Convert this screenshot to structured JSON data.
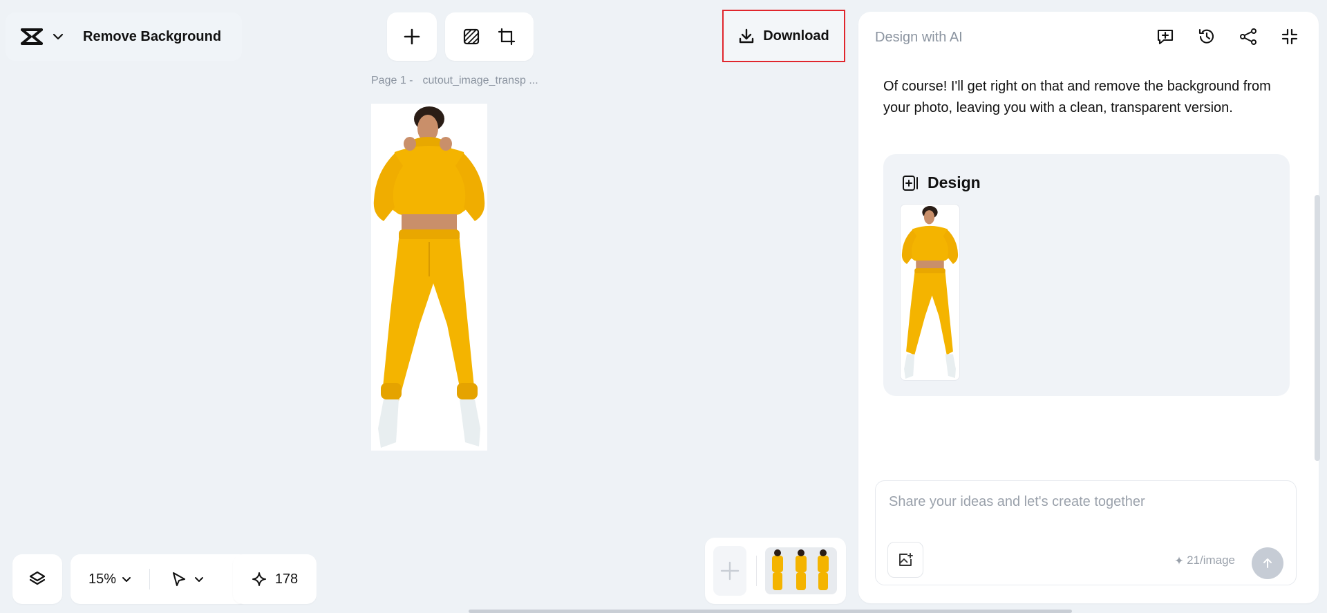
{
  "app": {
    "title": "Remove Background",
    "logo_icon": "capcut-logo-icon"
  },
  "toolbar": {
    "add_icon": "plus-icon",
    "tools": [
      "pattern-fill-icon",
      "resize-frame-icon"
    ],
    "download_label": "Download",
    "download_icon": "download-icon"
  },
  "canvas": {
    "page_label": "Page 1 -",
    "file_name": "cutout_image_transp ...",
    "image_description": "Person in yellow hoodie and sweatpants with white boots on transparent background"
  },
  "bottom_controls": {
    "layers_icon": "layers-icon",
    "zoom": "15%",
    "pointer_icon": "pointer-icon",
    "credits": "178",
    "credits_icon": "sparkle-icon"
  },
  "ai_panel": {
    "title": "Design with AI",
    "actions": [
      "new-chat-icon",
      "history-icon",
      "share-icon",
      "minimize-icon"
    ],
    "message": "Of course! I'll get right on that and remove the background from your photo, leaving you with a clean, transparent version.",
    "design_card_title": "Design",
    "input_placeholder": "Share your ideas and let's create together",
    "cost": "21/image"
  },
  "colors": {
    "background": "#eef2f6",
    "highlight": "#e0262d",
    "hoodie": "#f4b400",
    "boots": "#e8eef0"
  }
}
